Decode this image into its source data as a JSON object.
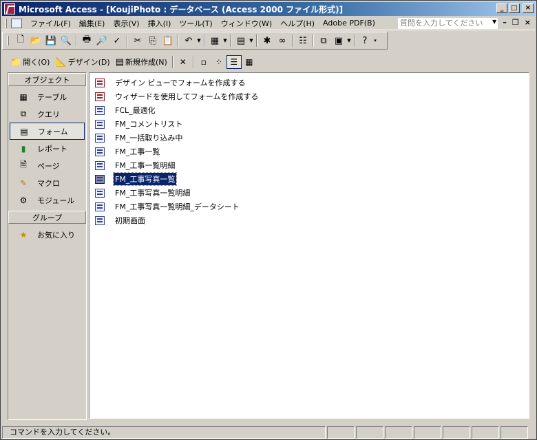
{
  "window": {
    "title": "Microsoft Access - [KoujiPhoto : データベース (Access 2000 ファイル形式)]"
  },
  "menu": {
    "items": [
      "ファイル(F)",
      "編集(E)",
      "表示(V)",
      "挿入(I)",
      "ツール(T)",
      "ウィンドウ(W)",
      "ヘルプ(H)",
      "Adobe PDF(B)"
    ],
    "help_placeholder": "質問を入力してください"
  },
  "db_toolbar": {
    "open_label": "開く(O)",
    "design_label": "デザイン(D)",
    "new_label": "新規作成(N)"
  },
  "objects_bar": {
    "objects_header": "オブジェクト",
    "groups_header": "グループ",
    "items": [
      "テーブル",
      "クエリ",
      "フォーム",
      "レポート",
      "ページ",
      "マクロ",
      "モジュール"
    ],
    "selected": "フォーム",
    "group_items": [
      "お気に入り"
    ]
  },
  "form_list": {
    "items": [
      "デザイン ビューでフォームを作成する",
      "ウィザードを使用してフォームを作成する",
      "FCL_最適化",
      "FM_コメントリスト",
      "FM_一括取り込み中",
      "FM_工事一覧",
      "FM_工事一覧明細",
      "FM_工事写真一覧",
      "FM_工事写真一覧明細",
      "FM_工事写真一覧明細_データシート",
      "初期画面"
    ],
    "selected": "FM_工事写真一覧"
  },
  "status": {
    "text": "コマンドを入力してください。"
  },
  "colors": {
    "titlebar": "#0a246a",
    "selection": "#0a246a",
    "chrome": "#d4d0c8"
  }
}
